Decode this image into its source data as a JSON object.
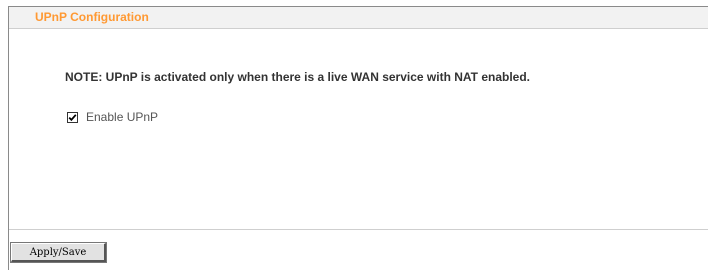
{
  "section": {
    "title": "UPnP Configuration"
  },
  "note": "NOTE: UPnP is activated only when there is a live WAN service with NAT enabled.",
  "enable_upnp": {
    "label": "Enable UPnP",
    "checked": true,
    "icon": "checkmark-icon"
  },
  "actions": {
    "apply_save_label": "Apply/Save"
  },
  "colors": {
    "title_accent": "#ff9933",
    "note_text": "#333333",
    "label_text": "#555555"
  }
}
